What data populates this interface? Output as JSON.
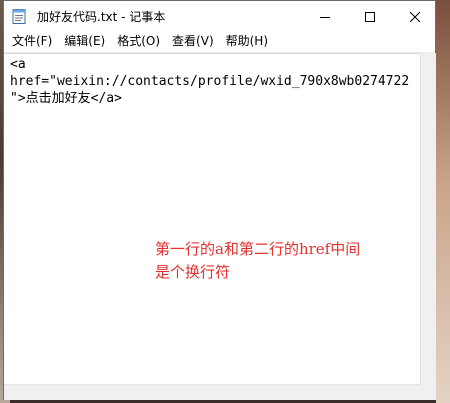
{
  "window": {
    "title": "加好友代码.txt - 记事本",
    "icon": "notepad-icon"
  },
  "window_controls": {
    "minimize_icon": "minimize-icon",
    "maximize_icon": "maximize-icon",
    "close_icon": "close-icon"
  },
  "menubar": {
    "items": [
      {
        "label": "文件(F)"
      },
      {
        "label": "编辑(E)"
      },
      {
        "label": "格式(O)"
      },
      {
        "label": "查看(V)"
      },
      {
        "label": "帮助(H)"
      }
    ]
  },
  "editor": {
    "lines": [
      "<a",
      "href=\"weixin://contacts/profile/wxid_790x8wb0274722",
      "\">点击加好友</a>"
    ]
  },
  "annotation": {
    "line1": "第一行的a和第二行的href中间",
    "line2": "是个换行符",
    "color": "#e53030"
  }
}
